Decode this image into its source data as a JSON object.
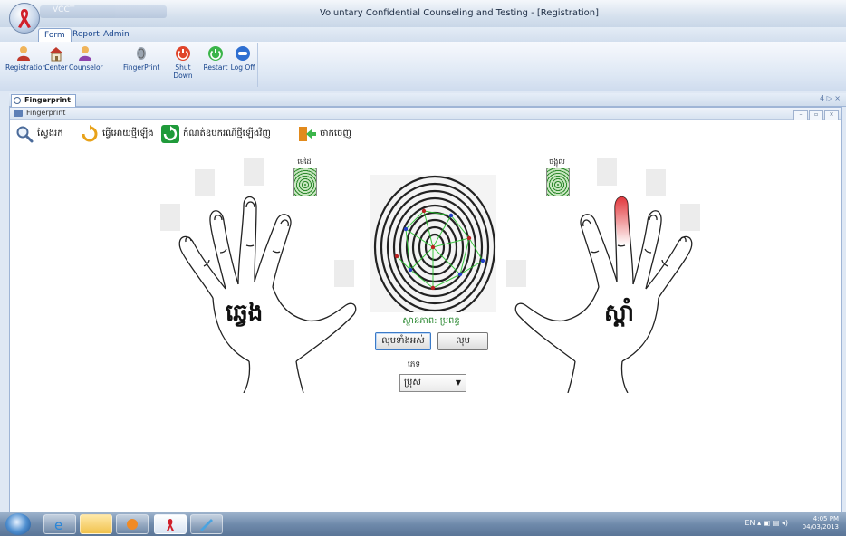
{
  "app": {
    "quick_access": "VCCT",
    "window_title": "Voluntary Confidential Counseling and Testing - [Registration]"
  },
  "ribbon": {
    "tabs": [
      "Form",
      "Report",
      "Admin"
    ],
    "active_tab": "Form",
    "buttons": [
      {
        "label": "Registration",
        "icon": "user-icon"
      },
      {
        "label": "Center",
        "icon": "home-icon"
      },
      {
        "label": "Counselor",
        "icon": "counselor-icon"
      },
      {
        "label": "FingerPrint",
        "icon": "fingerprint-icon"
      },
      {
        "label": "Shut Down",
        "icon": "power-icon"
      },
      {
        "label": "Restart",
        "icon": "restart-icon"
      },
      {
        "label": "Log Off",
        "icon": "logoff-icon"
      }
    ]
  },
  "document": {
    "tab_label": "Fingerprint",
    "form_caption": "Fingerprint",
    "tab_right": "4 ▷ ×"
  },
  "toolbar": {
    "search_label": "ស្វែងរក",
    "refresh_label": "ធ្វើអោយថ្មីឡើង",
    "rescan_label": "កំណត់ឧបករណ៍ថ្មីឡើងវិញ",
    "exit_label": "ចាកចេញ"
  },
  "fingerprint": {
    "left_label": "មេដៃ",
    "right_label": "ចង្អុល",
    "left_hand": "ឆ្វេង",
    "right_hand": "ស្តាំ",
    "status": "ស្ថានភាព: ប្រពន្ធ",
    "delete_all_button": "លុបទាំងអស់",
    "delete_button": "លុប",
    "sex_label": "ភេទ",
    "sex_value": "ប្រុស"
  },
  "taskbar": {
    "lang": "EN",
    "time": "4:05 PM",
    "date": "04/03/2013"
  }
}
